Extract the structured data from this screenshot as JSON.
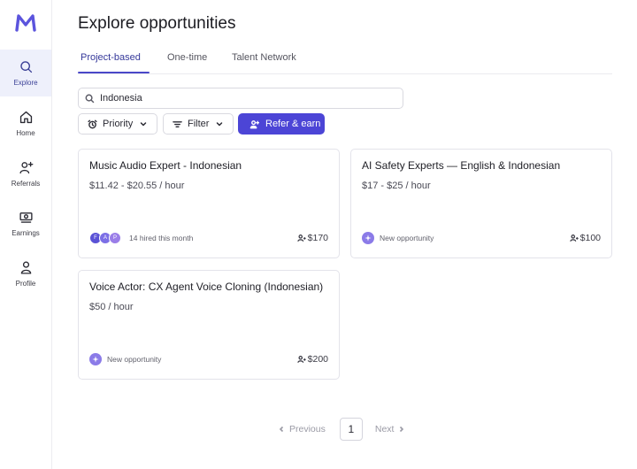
{
  "app": {
    "brand_color": "#4c45d6",
    "logo_icon": "m-logo-icon"
  },
  "sidebar": {
    "items": [
      {
        "label": "Explore",
        "icon": "search-icon",
        "active": true
      },
      {
        "label": "Home",
        "icon": "home-icon"
      },
      {
        "label": "Referrals",
        "icon": "user-plus-icon"
      },
      {
        "label": "Earnings",
        "icon": "money-icon"
      },
      {
        "label": "Profile",
        "icon": "person-icon"
      }
    ]
  },
  "page": {
    "title": "Explore opportunities"
  },
  "tabs": [
    {
      "label": "Project-based",
      "active": true
    },
    {
      "label": "One-time"
    },
    {
      "label": "Talent Network"
    }
  ],
  "search": {
    "value": "Indonesia",
    "icon": "search-icon"
  },
  "toolbar": {
    "priority_label": "Priority",
    "filter_label": "Filter",
    "refer_label": "Refer & earn"
  },
  "cards": [
    {
      "title": "Music Audio Expert - Indonesian",
      "pay": "$11.42 - $20.55 / hour",
      "avatars": [
        {
          "initial": "F",
          "color": "#5a52d6"
        },
        {
          "initial": "A",
          "color": "#7c6fe6"
        },
        {
          "initial": "P",
          "color": "#9a7ee8"
        }
      ],
      "footer_text": "14 hired this month",
      "reward": "$170"
    },
    {
      "title": "AI Safety Experts — English & Indonesian",
      "pay": "$17 - $25 / hour",
      "footer_text": "New opportunity",
      "reward": "$100"
    },
    {
      "title": "Voice Actor: CX Agent Voice Cloning (Indonesian)",
      "pay": "$50 / hour",
      "footer_text": "New opportunity",
      "reward": "$200"
    }
  ],
  "pagination": {
    "previous": "Previous",
    "current": "1",
    "next": "Next"
  }
}
